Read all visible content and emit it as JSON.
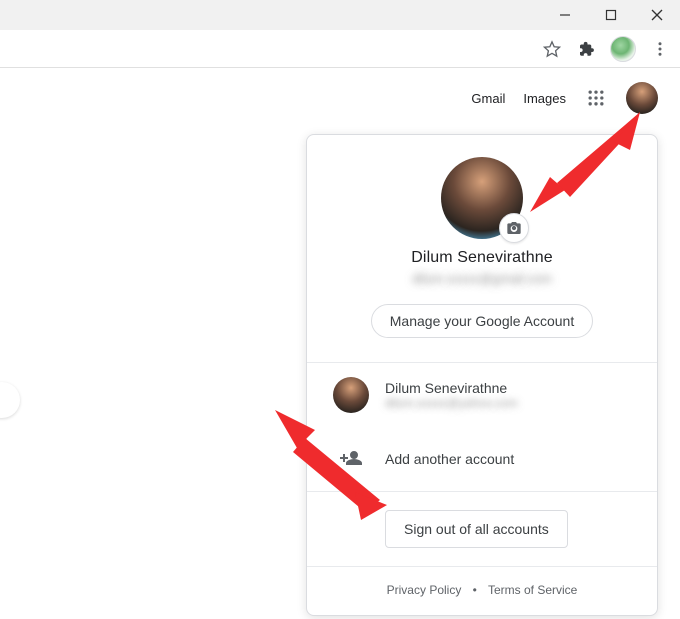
{
  "window_controls": {
    "minimize": "Minimize",
    "maximize": "Maximize",
    "close": "Close"
  },
  "toolbar": {
    "star_tooltip": "Bookmark this tab",
    "extensions_tooltip": "Extensions",
    "menu_tooltip": "Customize and control Google Chrome"
  },
  "header": {
    "gmail_label": "Gmail",
    "images_label": "Images",
    "apps_tooltip": "Google apps",
    "account_tooltip": "Google Account"
  },
  "account_popup": {
    "display_name": "Dilum Senevirathne",
    "primary_email_obscured": "dilum.xxxxx@gmail.com",
    "manage_label": "Manage your Google Account",
    "change_photo_tooltip": "Change profile photo",
    "other_accounts": [
      {
        "name": "Dilum Senevirathne",
        "email_obscured": "dilum.xxxxx@yahoo.com"
      }
    ],
    "add_account_label": "Add another account",
    "sign_out_label": "Sign out of all accounts",
    "footer": {
      "privacy_label": "Privacy Policy",
      "terms_label": "Terms of Service",
      "separator": "•"
    }
  }
}
